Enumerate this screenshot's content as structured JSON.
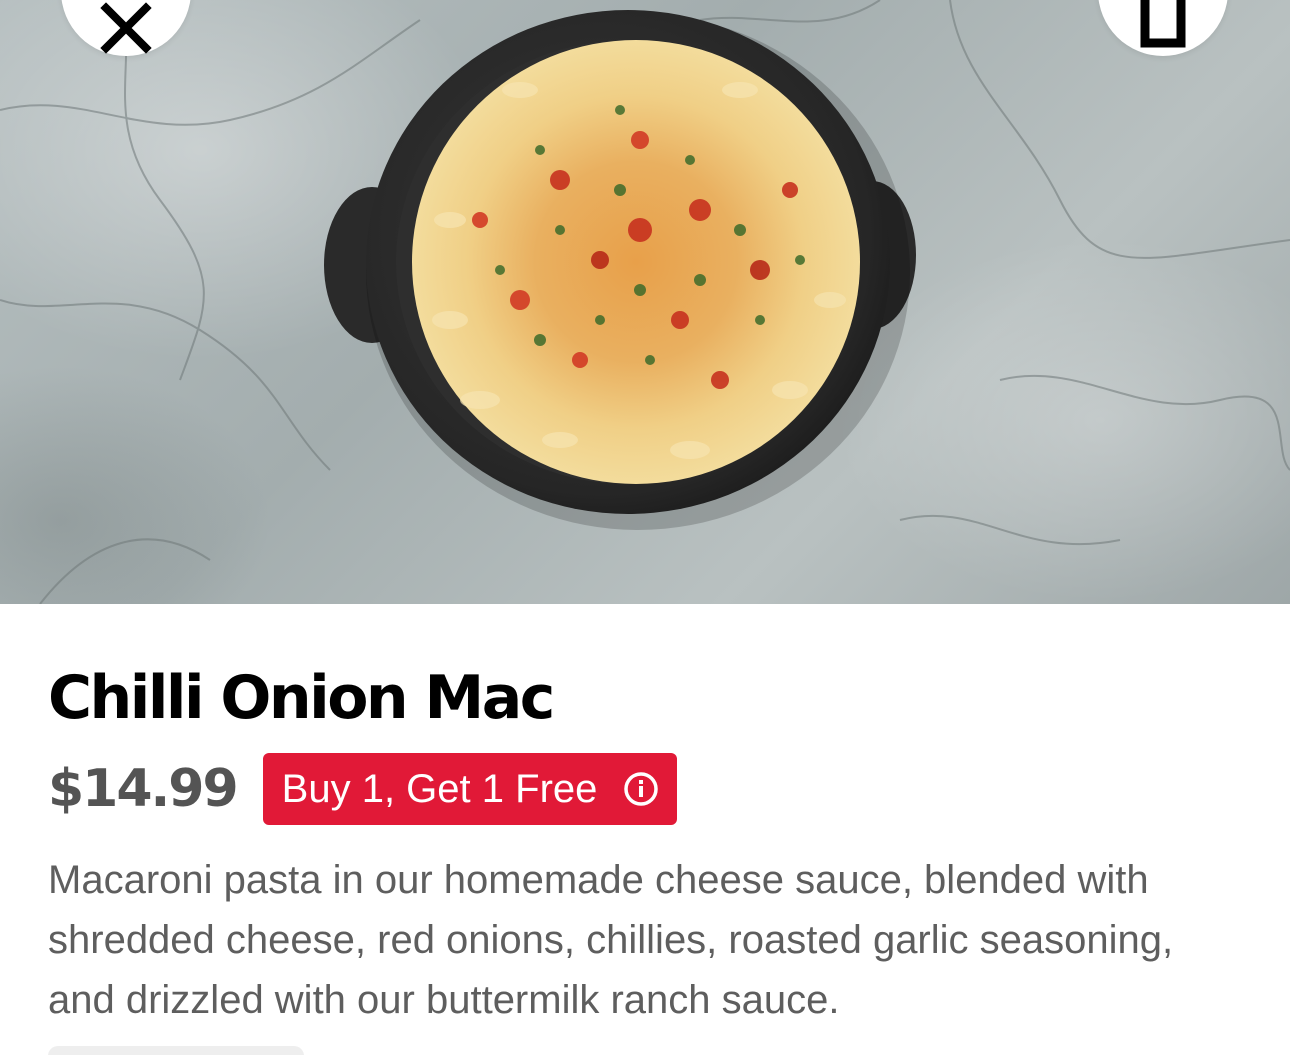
{
  "hero": {
    "image_alt": "Skillet of baked macaroni and cheese topped with chillies, onions and herbs"
  },
  "header": {
    "close_icon": "close-icon",
    "save_icon": "bookmark-icon"
  },
  "item": {
    "title": "Chilli Onion Mac",
    "price": "$14.99",
    "promo": {
      "label": "Buy 1, Get 1 Free",
      "icon": "info-icon",
      "color": "#e11937"
    },
    "description": "Macaroni pasta in our homemade cheese sauce, blended with shredded cheese, red onions, chillies, roasted garlic seasoning, and drizzled with our buttermilk ranch sauce."
  },
  "colors": {
    "title": "#000000",
    "price": "#545454",
    "description": "#5e5e5e",
    "promo_background": "#e11937"
  }
}
